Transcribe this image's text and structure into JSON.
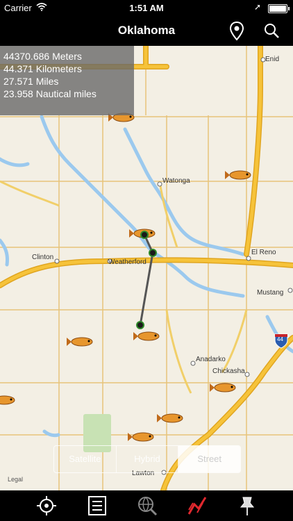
{
  "status_bar": {
    "carrier": "Carrier",
    "time": "1:51 AM"
  },
  "nav_bar": {
    "title": "Oklahoma",
    "icons": [
      "pin-icon",
      "search-icon"
    ]
  },
  "distance_panel": {
    "meters": "44370.686 Meters",
    "kilometers": "44.371 Kilometers",
    "miles": "27.571 Miles",
    "nautical": "23.958 Nautical miles"
  },
  "map": {
    "cities": [
      "Enid",
      "Watonga",
      "El Reno",
      "Clinton",
      "Weatherford",
      "Mustang",
      "Anadarko",
      "Chickasha",
      "Lawton"
    ],
    "highway_shield": "44",
    "legal": "Legal",
    "map_types": [
      "Satellite",
      "Hybrid",
      "Street"
    ],
    "selected_map_type": "Street",
    "colors": {
      "road": "#f6c33a",
      "road_outline": "#e0a520",
      "water": "#9bc9ee",
      "land": "#f3efe4",
      "park": "#c8e2b4",
      "measure_line": "#555555"
    }
  },
  "tab_bar": {
    "icons": [
      "crosshair-icon",
      "list-icon",
      "globe-search-icon",
      "measure-icon",
      "pushpin-icon"
    ]
  }
}
